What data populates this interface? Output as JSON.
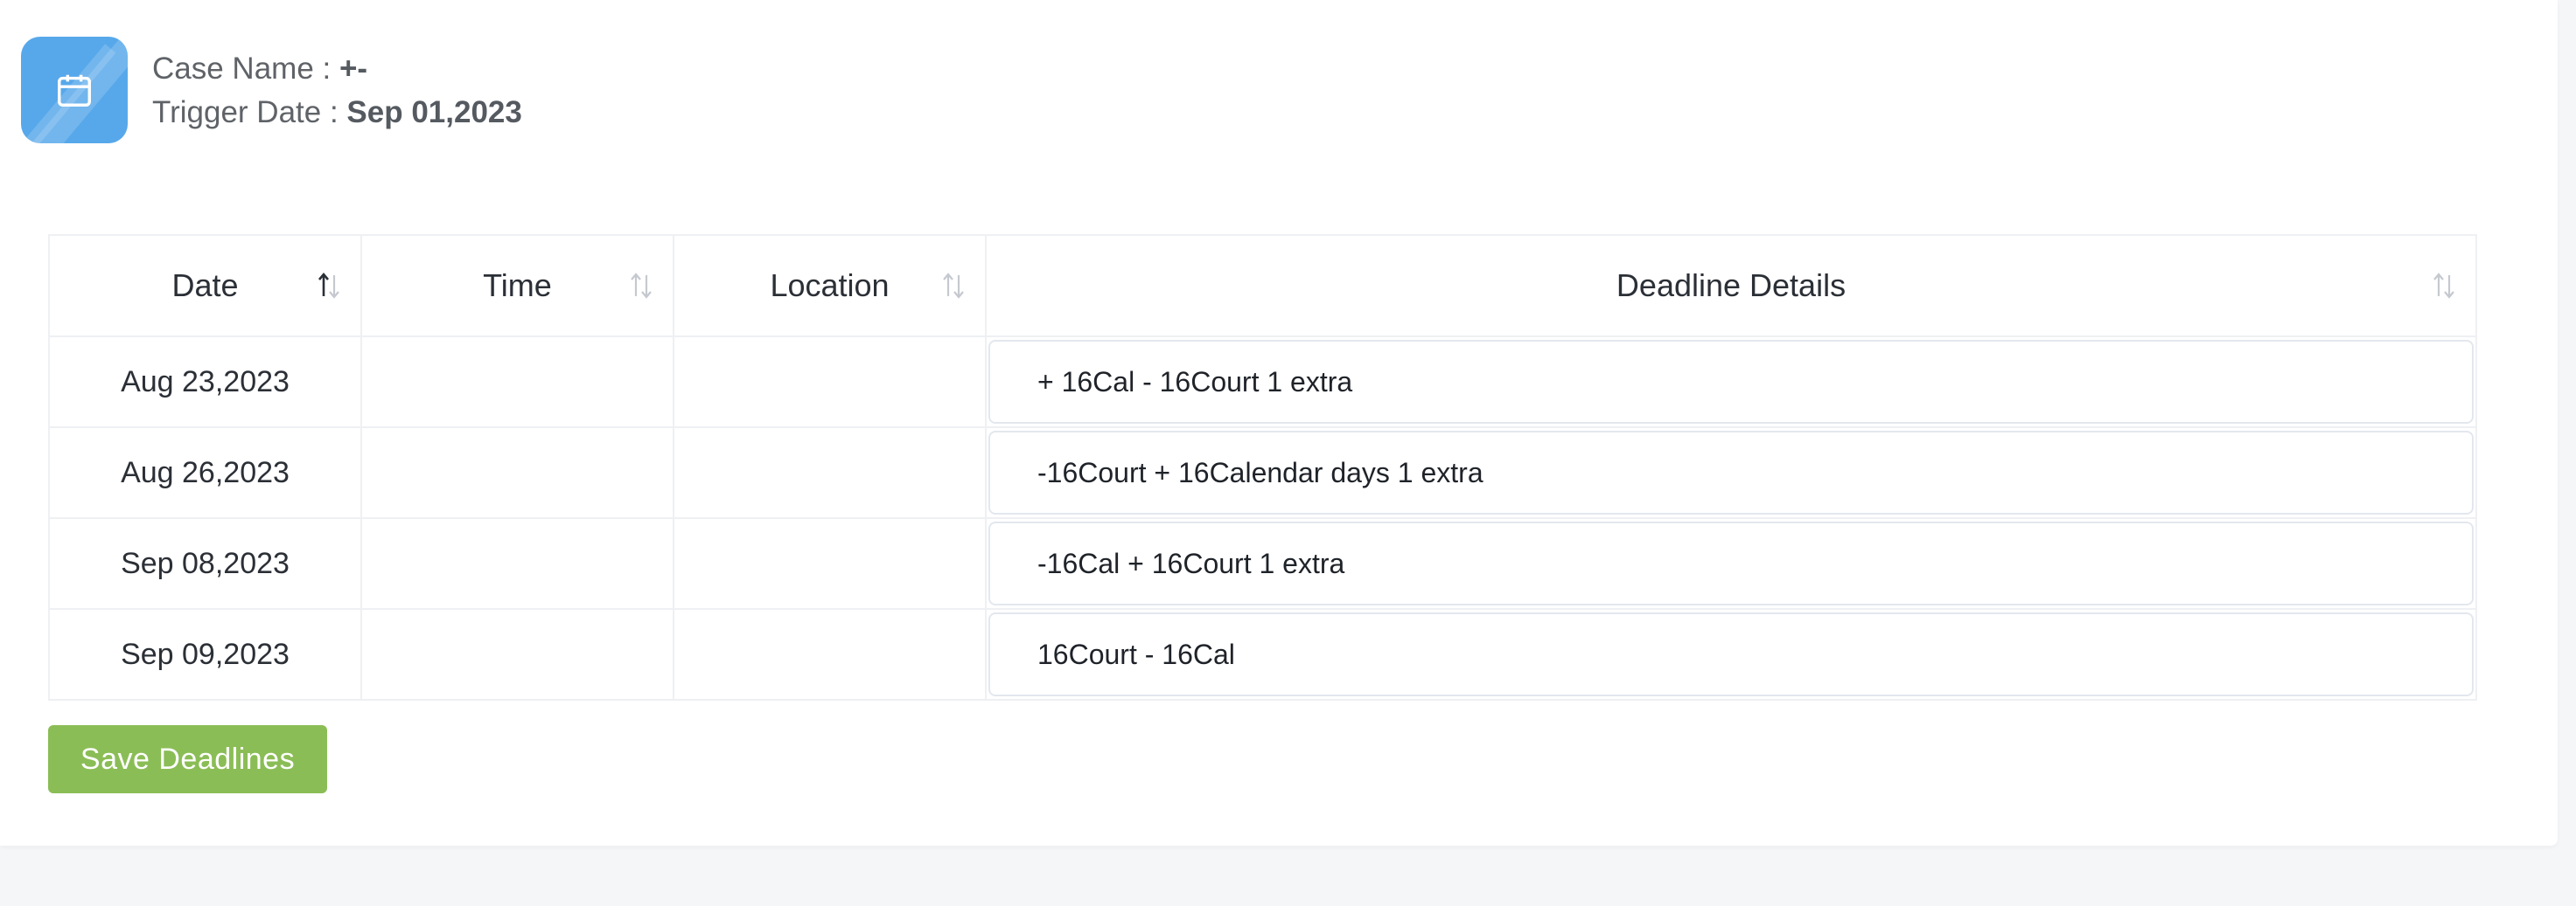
{
  "case": {
    "name_label": "Case Name :",
    "name_value": "+-",
    "trigger_label": "Trigger Date :",
    "trigger_value": "Sep 01,2023",
    "icon": "calendar-icon"
  },
  "table": {
    "columns": [
      "Date",
      "Time",
      "Location",
      "Deadline Details"
    ],
    "rows": [
      {
        "date": "Aug 23,2023",
        "time": "",
        "location": "",
        "details": "+ 16Cal - 16Court 1 extra"
      },
      {
        "date": "Aug 26,2023",
        "time": "",
        "location": "",
        "details": "-16Court + 16Calendar days 1 extra"
      },
      {
        "date": "Sep 08,2023",
        "time": "",
        "location": "",
        "details": "-16Cal + 16Court 1 extra"
      },
      {
        "date": "Sep 09,2023",
        "time": "",
        "location": "",
        "details": "16Court - 16Cal"
      }
    ]
  },
  "actions": {
    "save_label": "Save Deadlines"
  },
  "colors": {
    "icon_bg": "#57a8ea",
    "save_button": "#8bbd56",
    "border": "#eef0f3"
  }
}
